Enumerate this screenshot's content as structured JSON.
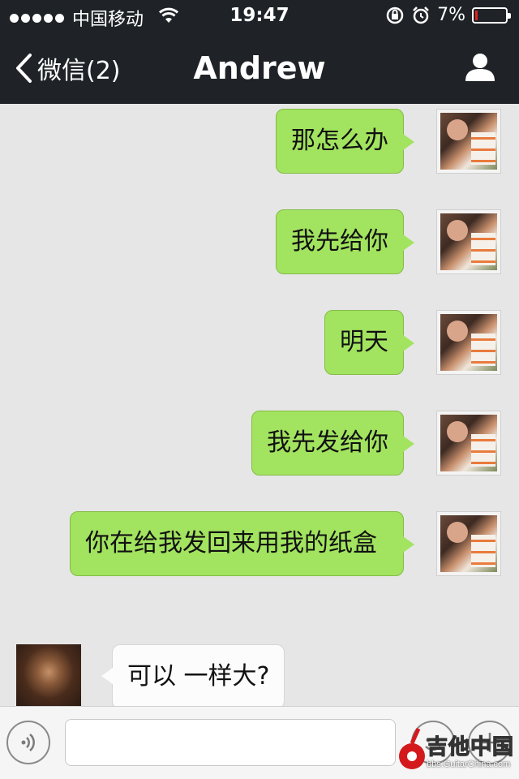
{
  "status_bar": {
    "carrier": "中国移动",
    "time": "19:47",
    "battery_percent_label": "7%",
    "battery_level": 0.07,
    "icons": [
      "signal-dots",
      "wifi-icon",
      "rotation-lock-icon",
      "alarm-icon",
      "battery-icon"
    ]
  },
  "nav": {
    "back_label": "微信(2)",
    "title": "Andrew",
    "profile_icon": "person-icon"
  },
  "messages": [
    {
      "side": "me",
      "text": "那怎么办"
    },
    {
      "side": "me",
      "text": "我先给你"
    },
    {
      "side": "me",
      "text": "明天"
    },
    {
      "side": "me",
      "text": "我先发给你"
    },
    {
      "side": "me",
      "text": "你在给我发回来用我的纸盒"
    },
    {
      "side": "them",
      "text": "可以 一样大?"
    }
  ],
  "input_bar": {
    "input_value": "",
    "voice_icon": "voice-icon",
    "emoji_icon": "emoji-icon",
    "plus_icon": "plus-icon"
  },
  "watermark": {
    "text": "吉他中国",
    "sub": "bbs.GuitarChina.com"
  },
  "colors": {
    "nav_bg": "#1f2327",
    "chat_bg": "#e6e6e6",
    "bubble_me": "#a2e35f",
    "bubble_them": "#fcfcfc"
  }
}
